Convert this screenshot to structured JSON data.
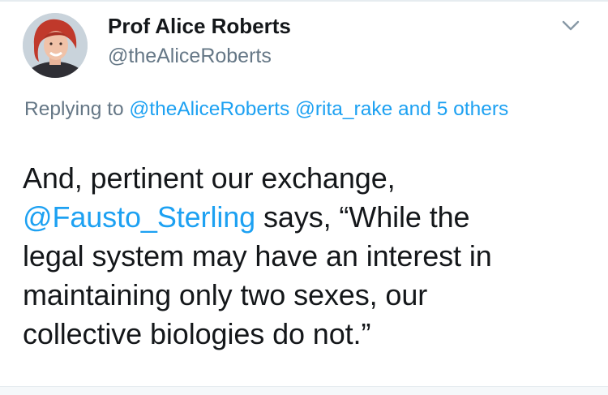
{
  "author": {
    "display_name": "Prof Alice Roberts",
    "handle": "@theAliceRoberts"
  },
  "reply": {
    "prefix": "Replying to ",
    "mention_1": "@theAliceRoberts",
    "space_1": " ",
    "mention_2": "@rita_rake",
    "space_2": " ",
    "others": "and 5 others"
  },
  "tweet": {
    "line_1": "And, pertinent our exchange,",
    "mention": "@Fausto_Sterling",
    "line_2_rest": " says, “While the",
    "line_3": "legal system may have an interest in",
    "line_4": "maintaining only two sexes, our",
    "line_5": "collective biologies do not.”"
  },
  "icons": {
    "menu": "chevron-down-icon",
    "avatar": "profile-photo"
  },
  "colors": {
    "link": "#1da1f2",
    "secondary_text": "#657786",
    "primary_text": "#14171a"
  }
}
